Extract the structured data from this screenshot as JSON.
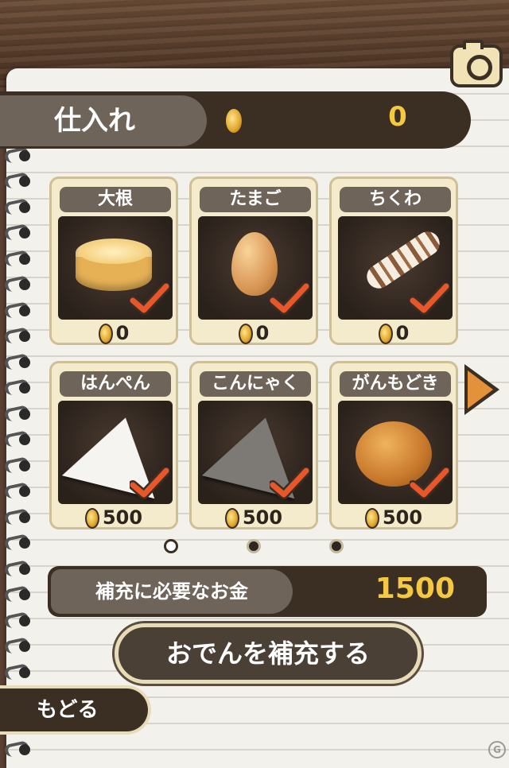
{
  "screen": {
    "title": "仕入れ",
    "balance": "0"
  },
  "items": [
    {
      "name": "大根",
      "price": "0",
      "checked": true,
      "food_icon": "daikon"
    },
    {
      "name": "たまご",
      "price": "0",
      "checked": true,
      "food_icon": "egg"
    },
    {
      "name": "ちくわ",
      "price": "0",
      "checked": true,
      "food_icon": "chikuwa"
    },
    {
      "name": "はんぺん",
      "price": "500",
      "checked": true,
      "food_icon": "hanpen"
    },
    {
      "name": "こんにゃく",
      "price": "500",
      "checked": true,
      "food_icon": "konnyaku"
    },
    {
      "name": "がんもどき",
      "price": "500",
      "checked": true,
      "food_icon": "ganmodoki"
    }
  ],
  "pagination": {
    "pages": 3,
    "current": 1
  },
  "cost": {
    "label": "補充に必要なお金",
    "value": "1500"
  },
  "buttons": {
    "refill": "おでんを補充する",
    "back": "もどる"
  },
  "colors": {
    "accent_gold": "#f4c840",
    "check_orange": "#e8562a",
    "panel_dark": "#3b2f24",
    "panel_gray": "#6e6459"
  },
  "icons": [
    "camera-icon",
    "coin-icon",
    "checkmark-icon",
    "next-arrow-icon"
  ]
}
